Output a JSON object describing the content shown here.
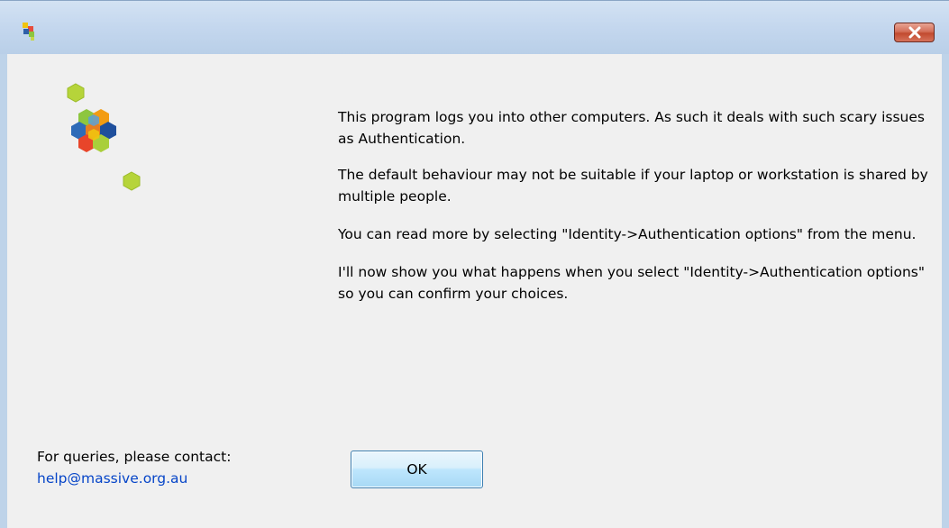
{
  "titlebar": {
    "app_icon": "app-cubes-icon",
    "close_icon": "close-icon",
    "close_color": "#c24a2f"
  },
  "logo": {
    "icon": "hexagon-cubes-logo-icon"
  },
  "message": {
    "paragraphs": [
      "This program logs you into other computers. As such it deals with such scary issues as Authentication.",
      "The default behaviour may not be suitable if your laptop or workstation is shared by multiple people.",
      "You can read more by selecting \"Identity->Authentication options\" from the menu.",
      "I'll now show you what happens when you select \"Identity->Authentication options\" so you can confirm your choices."
    ]
  },
  "contact": {
    "label": "For queries, please contact:",
    "email": "help@massive.org.au",
    "link_color": "#0645c8"
  },
  "buttons": {
    "ok_label": "OK"
  }
}
